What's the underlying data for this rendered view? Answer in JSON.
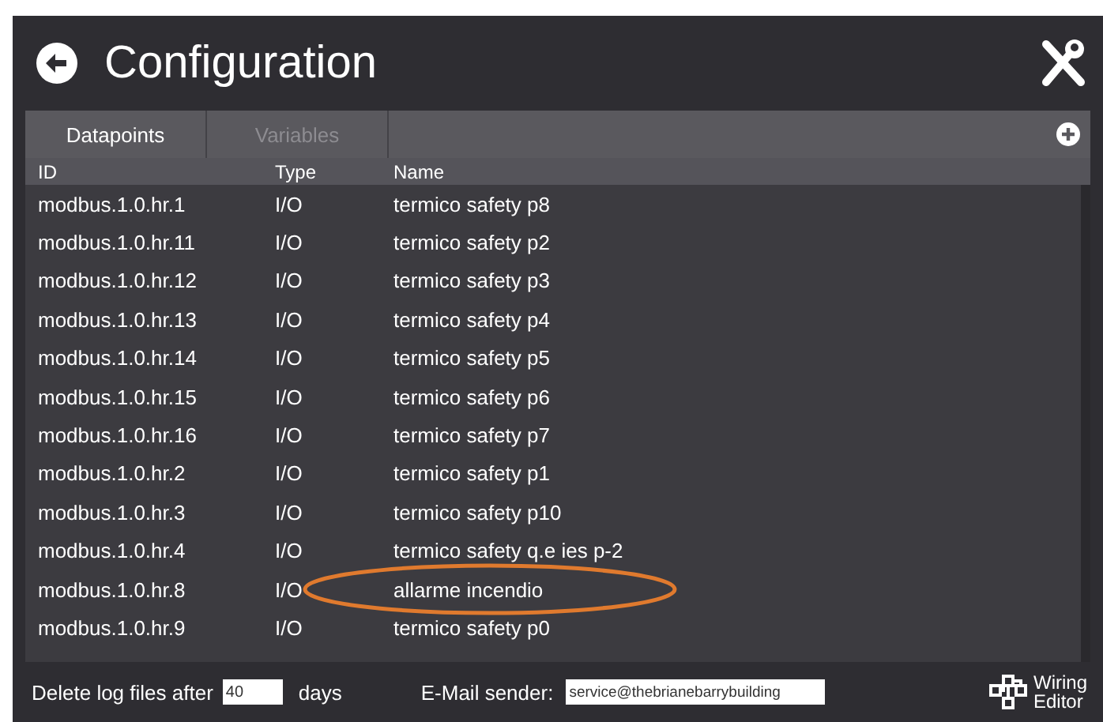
{
  "header": {
    "title": "Configuration"
  },
  "tabs": [
    {
      "label": "Datapoints",
      "selected": true
    },
    {
      "label": "Variables",
      "selected": false
    }
  ],
  "table": {
    "columns": [
      "ID",
      "Type",
      "Name"
    ],
    "rows": [
      {
        "id": "modbus.1.0.hr.1",
        "type": "I/O",
        "name": "termico safety p8",
        "circled": false
      },
      {
        "id": "modbus.1.0.hr.11",
        "type": "I/O",
        "name": "termico safety p2",
        "circled": false
      },
      {
        "id": "modbus.1.0.hr.12",
        "type": "I/O",
        "name": "termico safety p3",
        "circled": false
      },
      {
        "id": "modbus.1.0.hr.13",
        "type": "I/O",
        "name": "termico safety p4",
        "circled": false
      },
      {
        "id": "modbus.1.0.hr.14",
        "type": "I/O",
        "name": "termico safety p5",
        "circled": false
      },
      {
        "id": "modbus.1.0.hr.15",
        "type": "I/O",
        "name": "termico safety p6",
        "circled": false
      },
      {
        "id": "modbus.1.0.hr.16",
        "type": "I/O",
        "name": "termico safety p7",
        "circled": false
      },
      {
        "id": "modbus.1.0.hr.2",
        "type": "I/O",
        "name": "termico safety p1",
        "circled": false
      },
      {
        "id": "modbus.1.0.hr.3",
        "type": "I/O",
        "name": "termico safety p10",
        "circled": false
      },
      {
        "id": "modbus.1.0.hr.4",
        "type": "I/O",
        "name": "termico safety q.e ies p-2",
        "circled": false
      },
      {
        "id": "modbus.1.0.hr.8",
        "type": "I/O",
        "name": "allarme incendio",
        "circled": true
      },
      {
        "id": "modbus.1.0.hr.9",
        "type": "I/O",
        "name": "termico safety p0",
        "circled": false
      }
    ]
  },
  "footer": {
    "log_label": "Delete log files after",
    "log_days": "40",
    "days_label": "days",
    "email_label": "E-Mail sender:",
    "email_value": "service@thebrianebarrybuilding",
    "wiring_label": "Wiring Editor"
  }
}
